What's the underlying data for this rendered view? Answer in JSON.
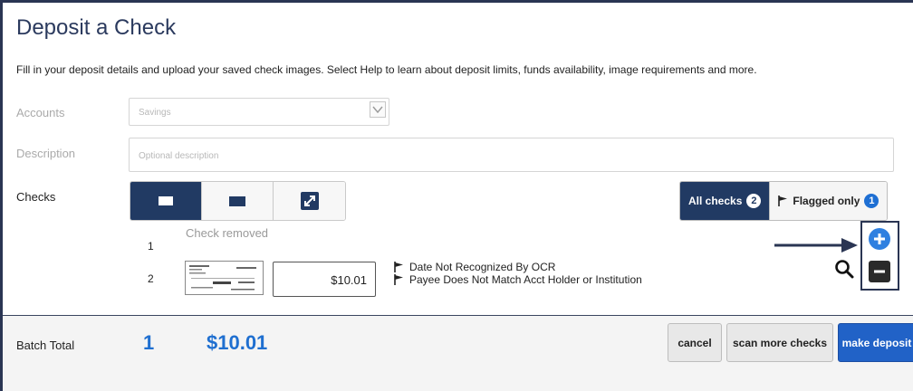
{
  "title": "Deposit a Check",
  "intro": "Fill in your deposit details and upload your saved check images. Select Help to learn about deposit limits, funds availability, image requirements and more.",
  "accounts": {
    "label": "Accounts",
    "value": "Savings"
  },
  "description": {
    "label": "Description",
    "placeholder": "Optional description"
  },
  "checks": {
    "label": "Checks",
    "filters": {
      "all_label": "All checks",
      "all_count": "2",
      "flagged_label": "Flagged only",
      "flagged_count": "1"
    },
    "rows": [
      {
        "num": "1",
        "status": "Check removed"
      },
      {
        "num": "2",
        "amount": "$10.01",
        "flags": [
          "Date Not Recognized By OCR",
          "Payee Does Not Match Acct Holder or Institution"
        ]
      }
    ]
  },
  "footer": {
    "batch_label": "Batch Total",
    "batch_count": "1",
    "batch_total": "$10.01",
    "cancel": "cancel",
    "scan_more": "scan more checks",
    "make_deposit": "make deposit"
  },
  "colors": {
    "navy": "#213a63",
    "accent_blue": "#1f6fd0",
    "primary_button": "#2162c7"
  }
}
